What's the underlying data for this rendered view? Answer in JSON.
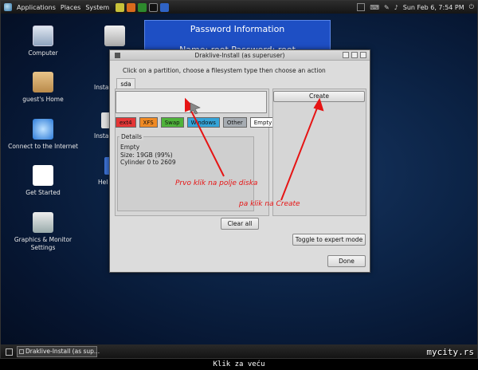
{
  "top_panel": {
    "menus": [
      "Applications",
      "Places",
      "System"
    ],
    "clock": "Sun Feb 6, 7:54 PM"
  },
  "desktop_icons": [
    {
      "label": "Computer",
      "icon": "computer-icon"
    },
    {
      "label": "guest's Home",
      "icon": "home-folder-icon"
    },
    {
      "label": "Connect to the Internet",
      "icon": "network-icon"
    },
    {
      "label": "Get Started",
      "icon": "gnu-icon"
    },
    {
      "label": "Graphics & Monitor\nSettings",
      "icon": "settings-sliders-icon"
    },
    {
      "label": "Instal",
      "icon": "trash-icon"
    },
    {
      "label": "Instal",
      "icon": "installer-icon"
    },
    {
      "label": "Hel",
      "icon": "help-icon"
    }
  ],
  "banner": {
    "title": "Password Information",
    "credentials": "Name: root     Password: root"
  },
  "dialog": {
    "title": "Draklive-Install (as superuser)",
    "instruction": "Click on a partition, choose a filesystem type then choose an action",
    "tab": "sda",
    "filesystems": [
      {
        "label": "ext4",
        "color": "#e53636"
      },
      {
        "label": "XFS",
        "color": "#f08a24"
      },
      {
        "label": "Swap",
        "color": "#4fb33a"
      },
      {
        "label": "Windows",
        "color": "#35a4d8"
      },
      {
        "label": "Other",
        "color": "#a6acb2"
      },
      {
        "label": "Empty",
        "color": "#ffffff"
      }
    ],
    "details_legend": "Details",
    "details": [
      "Empty",
      "Size: 19GB (99%)",
      "Cylinder 0 to 2609"
    ],
    "create_label": "Create",
    "clear_all_label": "Clear all",
    "expert_mode_label": "Toggle to expert mode",
    "done_label": "Done"
  },
  "annotations": {
    "first": "Prvo klik na polje diska",
    "second": "pa klik na Create",
    "color": "#e61414"
  },
  "bottom_panel": {
    "task": "Draklive-Install (as sup..."
  },
  "watermark": "mycity.rs",
  "caption": "Klik za veću"
}
